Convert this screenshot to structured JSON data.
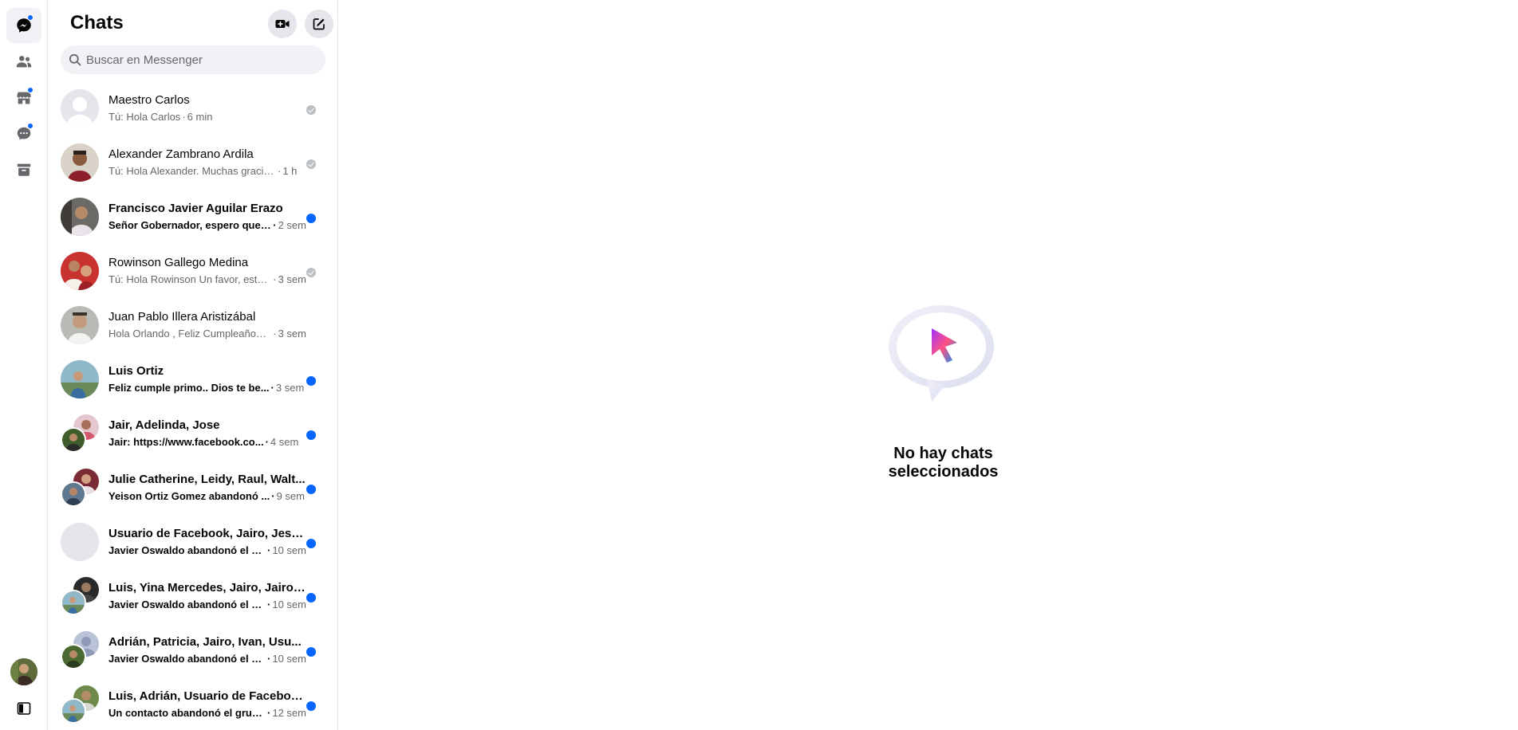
{
  "rail": {
    "items": [
      {
        "icon": "chat-bubble-icon",
        "active": true,
        "badge": true
      },
      {
        "icon": "people-icon",
        "active": false,
        "badge": false
      },
      {
        "icon": "marketplace-icon",
        "active": false,
        "badge": true
      },
      {
        "icon": "message-requests-icon",
        "active": false,
        "badge": true
      },
      {
        "icon": "archive-icon",
        "active": false,
        "badge": false
      }
    ],
    "bottom_icon": "sidebar-toggle-icon"
  },
  "panel": {
    "title": "Chats",
    "new_video_icon": "video-plus-icon",
    "compose_icon": "compose-icon",
    "search_placeholder": "Buscar en Messenger"
  },
  "chats": [
    {
      "name": "Maestro Carlos",
      "message": "Tú: Hola Carlos",
      "time": "6 min",
      "status": "seen",
      "unread": false,
      "avatar": "placeholder"
    },
    {
      "name": "Alexander Zambrano Ardila",
      "message": "Tú: Hola Alexander. Muchas gracias ...",
      "time": "1 h",
      "status": "seen",
      "unread": false,
      "avatar": "photo"
    },
    {
      "name": "Francisco Javier Aguilar Erazo",
      "message": "Señor Gobernador, espero que ...",
      "time": "2 sem",
      "status": "unread",
      "unread": true,
      "avatar": "photo"
    },
    {
      "name": "Rowinson Gallego Medina",
      "message": "Tú: Hola Rowinson Un favor, estoy...",
      "time": "3 sem",
      "status": "seen",
      "unread": false,
      "avatar": "photo"
    },
    {
      "name": "Juan Pablo Illera Aristizábal",
      "message": "Hola Orlando , Feliz Cumpleaños ...",
      "time": "3 sem",
      "status": "none",
      "unread": false,
      "avatar": "photo"
    },
    {
      "name": "Luis Ortiz",
      "message": "Feliz cumple primo.. Dios te be...",
      "time": "3 sem",
      "status": "unread",
      "unread": true,
      "avatar": "photo"
    },
    {
      "name": "Jair, Adelinda, Jose",
      "message": "Jair: https://www.facebook.co...",
      "time": "4 sem",
      "status": "unread",
      "unread": true,
      "avatar": "group"
    },
    {
      "name": "Julie Catherine, Leidy, Raul, Walt...",
      "message": "Yeison Ortiz Gomez abandonó ...",
      "time": "9 sem",
      "status": "unread",
      "unread": true,
      "avatar": "group"
    },
    {
      "name": "Usuario de Facebook, Jairo, Jesu...",
      "message": "Javier Oswaldo abandonó el g...",
      "time": "10 sem",
      "status": "unread",
      "unread": true,
      "avatar": "placeholder-light"
    },
    {
      "name": "Luis, Yina Mercedes, Jairo, Jairo,...",
      "message": "Javier Oswaldo abandonó el g...",
      "time": "10 sem",
      "status": "unread",
      "unread": true,
      "avatar": "group"
    },
    {
      "name": "Adrián, Patricia, Jairo, Ivan, Usu...",
      "message": "Javier Oswaldo abandonó el g...",
      "time": "10 sem",
      "status": "unread",
      "unread": true,
      "avatar": "group"
    },
    {
      "name": "Luis, Adrián, Usuario de Faceboo...",
      "message": "Un contacto abandonó el grupo.",
      "time": "12 sem",
      "status": "unread",
      "unread": true,
      "avatar": "group"
    }
  ],
  "main": {
    "empty_icon": "messenger-cursor-bubble-icon",
    "empty_text": "No hay chats seleccionados"
  },
  "colors": {
    "accent": "#0866ff",
    "text": "#050505",
    "secondary_text": "#65676b",
    "hover_bg": "#f0f2f5"
  }
}
